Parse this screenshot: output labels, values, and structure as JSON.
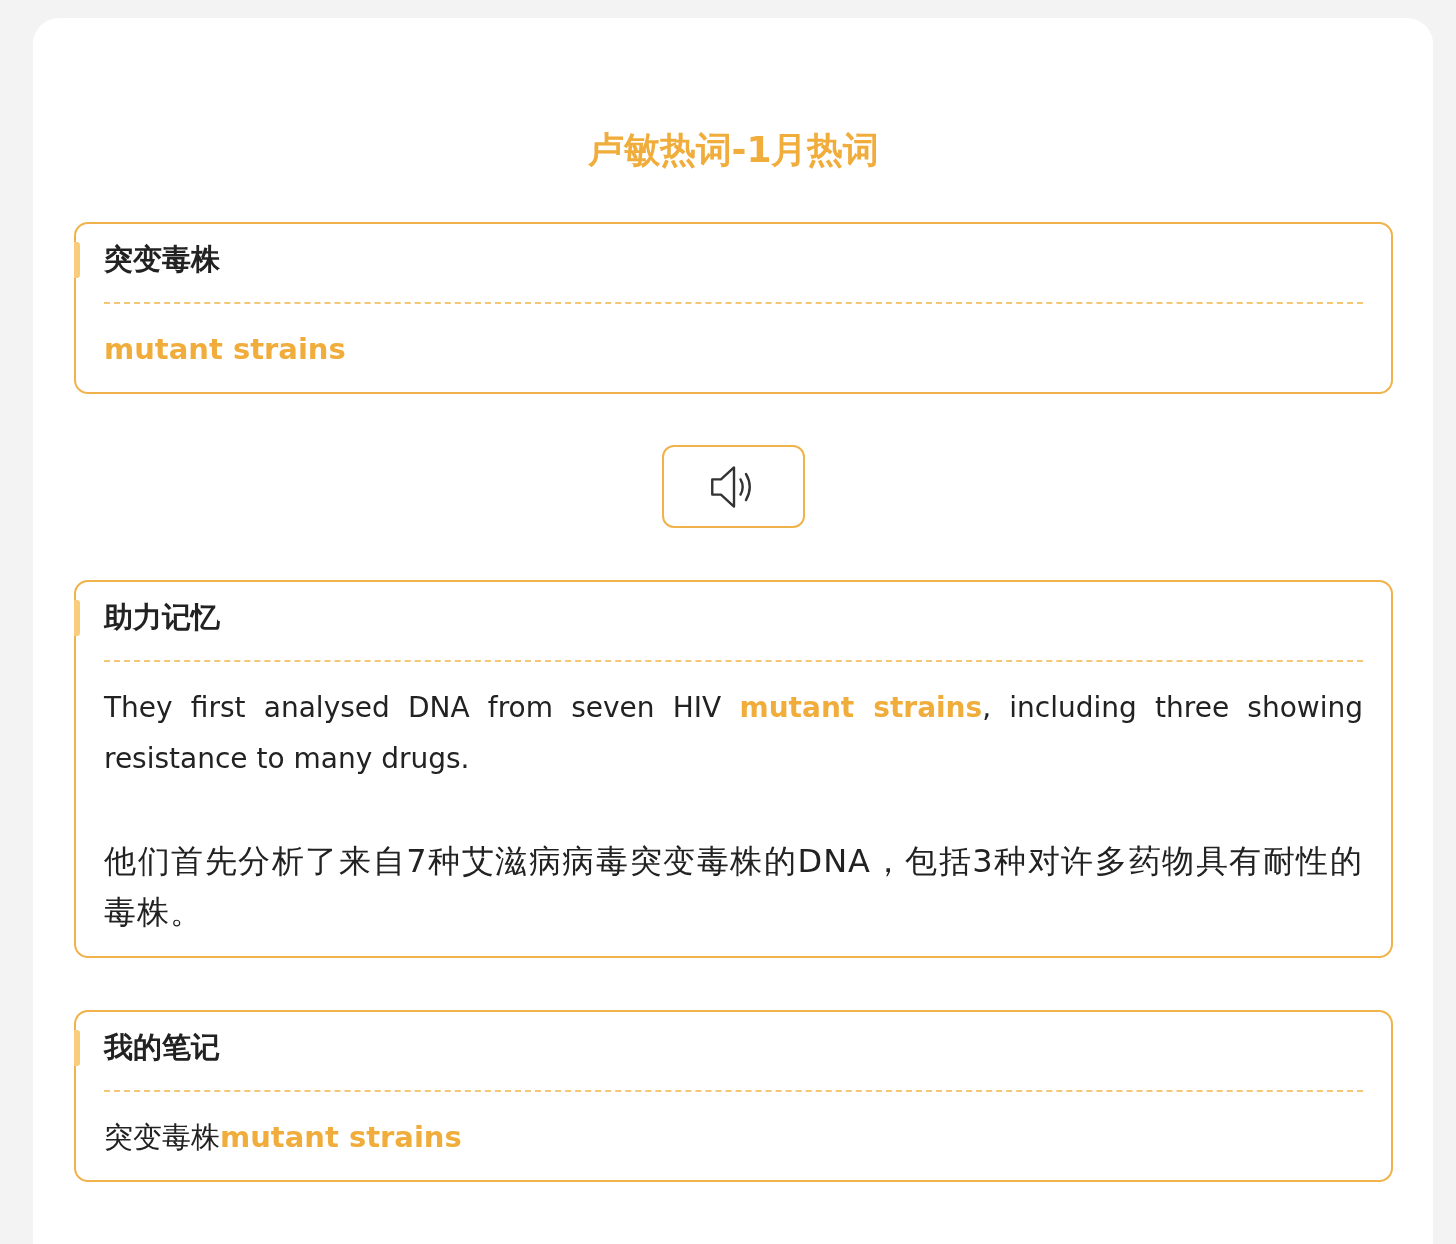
{
  "title": "卢敏热词-1月热词",
  "word_card": {
    "heading": "突变毒株",
    "word": "mutant strains"
  },
  "memory_card": {
    "heading": "助力记忆",
    "paragraphs": [
      {
        "kind": "english",
        "text": "They first analysed DNA from seven HIV **mutant strains**, including three showing resistance to many drugs."
      },
      {
        "kind": "chinese",
        "text": "他们首先分析了来自7种艾滋病病毒突变毒株的DNA，包括3种对许多药物具有耐性的毒株。"
      }
    ]
  },
  "notes_card": {
    "heading": "我的笔记",
    "note": "突变毒株**mutant strains**"
  }
}
